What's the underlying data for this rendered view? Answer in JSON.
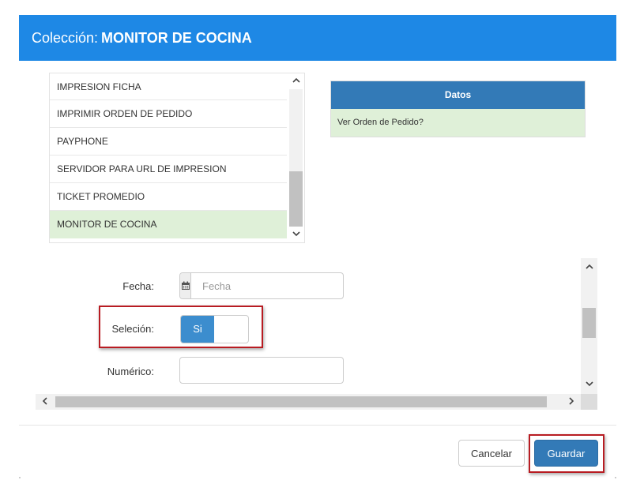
{
  "header": {
    "prefix": "Colección:",
    "title": "MONITOR DE COCINA"
  },
  "collection_list": {
    "items": [
      {
        "label": "IMPRESION FICHA",
        "selected": false
      },
      {
        "label": "IMPRIMIR ORDEN DE PEDIDO",
        "selected": false
      },
      {
        "label": "PAYPHONE",
        "selected": false
      },
      {
        "label": "SERVIDOR PARA URL DE IMPRESION",
        "selected": false
      },
      {
        "label": "TICKET PROMEDIO",
        "selected": false
      },
      {
        "label": "MONITOR DE COCINA",
        "selected": true
      }
    ],
    "scroll_up_icon": "chevron-up-icon",
    "scroll_down_icon": "chevron-down-icon"
  },
  "datos_table": {
    "header": "Datos",
    "rows": [
      "Ver Orden de Pedido?"
    ]
  },
  "form": {
    "fecha": {
      "label": "Fecha:",
      "placeholder": "Fecha",
      "value": "",
      "icon": "calendar-icon"
    },
    "seleccion": {
      "label": "Seleción:",
      "toggle_label": "Si",
      "on": true
    },
    "numerico": {
      "label": "Numérico:",
      "value": ""
    }
  },
  "scrollbars": {
    "left_arrow": "‹",
    "right_arrow": "›",
    "up_arrow": "˄",
    "down_arrow": "˅"
  },
  "footer": {
    "cancel_label": "Cancelar",
    "save_label": "Guardar"
  },
  "colors": {
    "header_bg": "#1e88e5",
    "table_header_bg": "#337ab7",
    "selected_row_bg": "#dff0d8",
    "highlight_border": "#b81c22"
  }
}
